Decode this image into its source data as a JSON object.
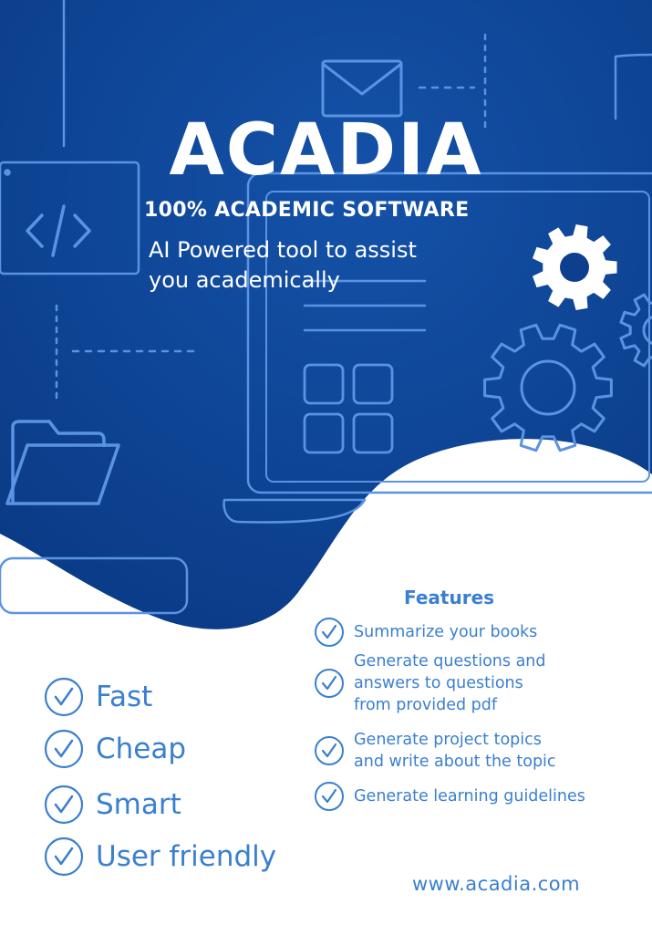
{
  "brand": {
    "title": "ACADIA",
    "subtitle": "100% ACADEMIC SOFTWARE",
    "tagline_lines": [
      "AI Powered tool to assist",
      "you academically"
    ]
  },
  "features": {
    "heading": "Features",
    "items": [
      {
        "lines": [
          "Summarize your books"
        ]
      },
      {
        "lines": [
          "Generate questions and",
          "answers to questions",
          "from provided pdf"
        ]
      },
      {
        "lines": [
          "Generate project topics",
          "and write about the topic"
        ]
      },
      {
        "lines": [
          "Generate learning guidelines"
        ]
      }
    ]
  },
  "qualities": [
    "Fast",
    "Cheap",
    "Smart",
    "User friendly"
  ],
  "website": "www.acadia.com",
  "colors": {
    "background_blue": "#0b3d8c",
    "line_art": "#5b93e3",
    "accent_text": "#3a7fd0",
    "white": "#ffffff"
  },
  "icons": [
    "envelope-icon",
    "code-icon",
    "folder-icon",
    "gear-icon",
    "grid-icon",
    "laptop-icon",
    "checkmark-icon"
  ]
}
